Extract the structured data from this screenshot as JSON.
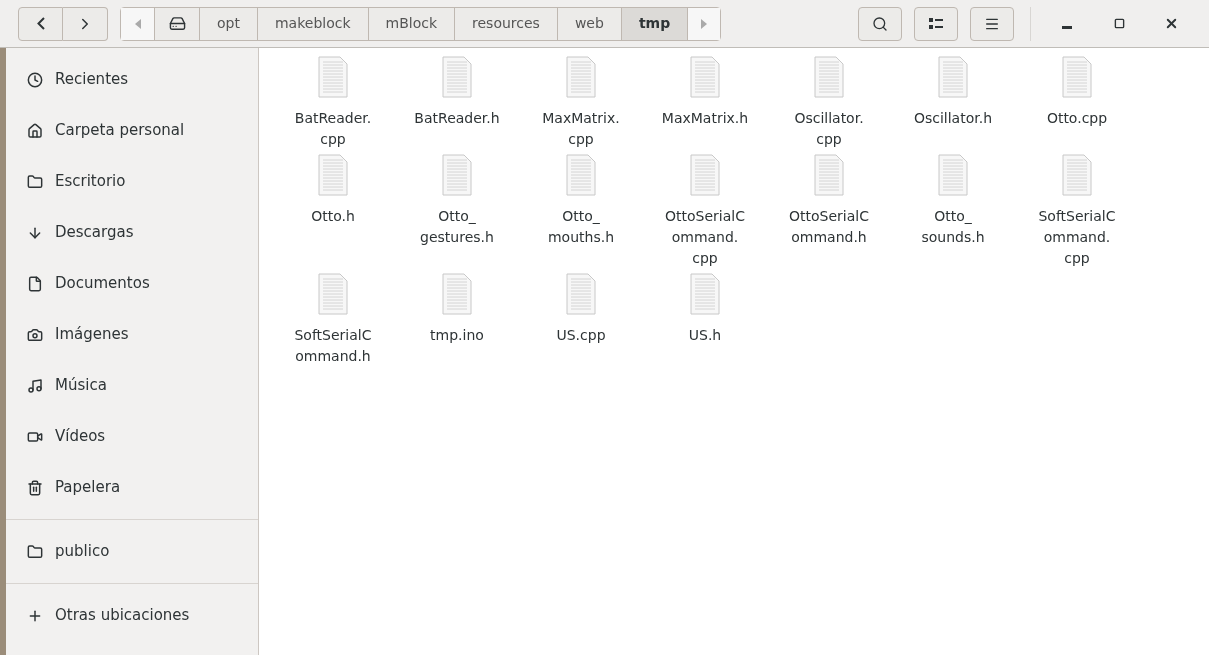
{
  "path_bar": {
    "crumbs": [
      {
        "label": "opt",
        "selected": false
      },
      {
        "label": "makeblock",
        "selected": false
      },
      {
        "label": "mBlock",
        "selected": false
      },
      {
        "label": "resources",
        "selected": false
      },
      {
        "label": "web",
        "selected": false
      },
      {
        "label": "tmp",
        "selected": true
      }
    ]
  },
  "sidebar": {
    "sections": [
      [
        {
          "label": "Recientes"
        },
        {
          "label": "Carpeta personal"
        },
        {
          "label": "Escritorio"
        },
        {
          "label": "Descargas"
        },
        {
          "label": "Documentos"
        },
        {
          "label": "Imágenes"
        },
        {
          "label": "Música"
        },
        {
          "label": "Vídeos"
        },
        {
          "label": "Papelera"
        }
      ],
      [
        {
          "label": "publico"
        }
      ],
      [
        {
          "label": "Otras ubicaciones"
        }
      ]
    ]
  },
  "files": [
    {
      "name_lines": [
        "BatReader.",
        "cpp"
      ]
    },
    {
      "name_lines": [
        "BatReader.h"
      ]
    },
    {
      "name_lines": [
        "MaxMatrix.",
        "cpp"
      ]
    },
    {
      "name_lines": [
        "MaxMatrix.h"
      ]
    },
    {
      "name_lines": [
        "Oscillator.",
        "cpp"
      ]
    },
    {
      "name_lines": [
        "Oscillator.h"
      ]
    },
    {
      "name_lines": [
        "Otto.cpp"
      ]
    },
    {
      "name_lines": [
        "Otto.h"
      ]
    },
    {
      "name_lines": [
        "Otto_",
        "gestures.h"
      ]
    },
    {
      "name_lines": [
        "Otto_",
        "mouths.h"
      ]
    },
    {
      "name_lines": [
        "OttoSerialC",
        "ommand.",
        "cpp"
      ]
    },
    {
      "name_lines": [
        "OttoSerialC",
        "ommand.h"
      ]
    },
    {
      "name_lines": [
        "Otto_",
        "sounds.h"
      ]
    },
    {
      "name_lines": [
        "SoftSerialC",
        "ommand.",
        "cpp"
      ]
    },
    {
      "name_lines": [
        "SoftSerialC",
        "ommand.h"
      ]
    },
    {
      "name_lines": [
        "tmp.ino"
      ]
    },
    {
      "name_lines": [
        "US.cpp"
      ]
    },
    {
      "name_lines": [
        "US.h"
      ]
    }
  ]
}
